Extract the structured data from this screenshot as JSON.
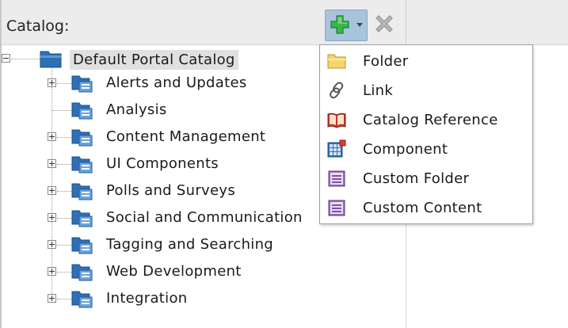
{
  "header": {
    "label": "Catalog:",
    "add_icon": "green-plus-icon",
    "dropdown_icon": "caret-down-icon",
    "delete_icon": "gray-x-icon"
  },
  "tree": {
    "root": {
      "label": "Default Portal Catalog",
      "icon": "folder-blue-icon"
    },
    "children": [
      {
        "label": "Alerts and Updates",
        "icon": "alerts-folder-icon"
      },
      {
        "label": "Analysis",
        "icon": "analysis-folder-icon"
      },
      {
        "label": "Content Management",
        "icon": "content-folder-icon"
      },
      {
        "label": "UI Components",
        "icon": "ui-folder-icon"
      },
      {
        "label": "Polls and Surveys",
        "icon": "polls-folder-icon"
      },
      {
        "label": "Social and Communication",
        "icon": "social-folder-icon"
      },
      {
        "label": "Tagging and Searching",
        "icon": "tagging-folder-icon"
      },
      {
        "label": "Web Development",
        "icon": "webdev-folder-icon"
      },
      {
        "label": "Integration",
        "icon": "integration-folder-icon"
      }
    ]
  },
  "add_menu": {
    "items": [
      {
        "label": "Folder",
        "icon": "yellow-folder-icon"
      },
      {
        "label": "Link",
        "icon": "chain-link-icon"
      },
      {
        "label": "Catalog Reference",
        "icon": "book-icon"
      },
      {
        "label": "Component",
        "icon": "grid-component-icon"
      },
      {
        "label": "Custom Folder",
        "icon": "purple-folder-icon"
      },
      {
        "label": "Custom Content",
        "icon": "purple-content-icon"
      }
    ]
  },
  "colors": {
    "folder_blue": "#2f6fb5",
    "folder_yellow": "#f3d66b",
    "plus_green": "#3bb54a",
    "toolbar_selected": "#a8c4dd",
    "root_highlight": "#e0e0e0"
  }
}
